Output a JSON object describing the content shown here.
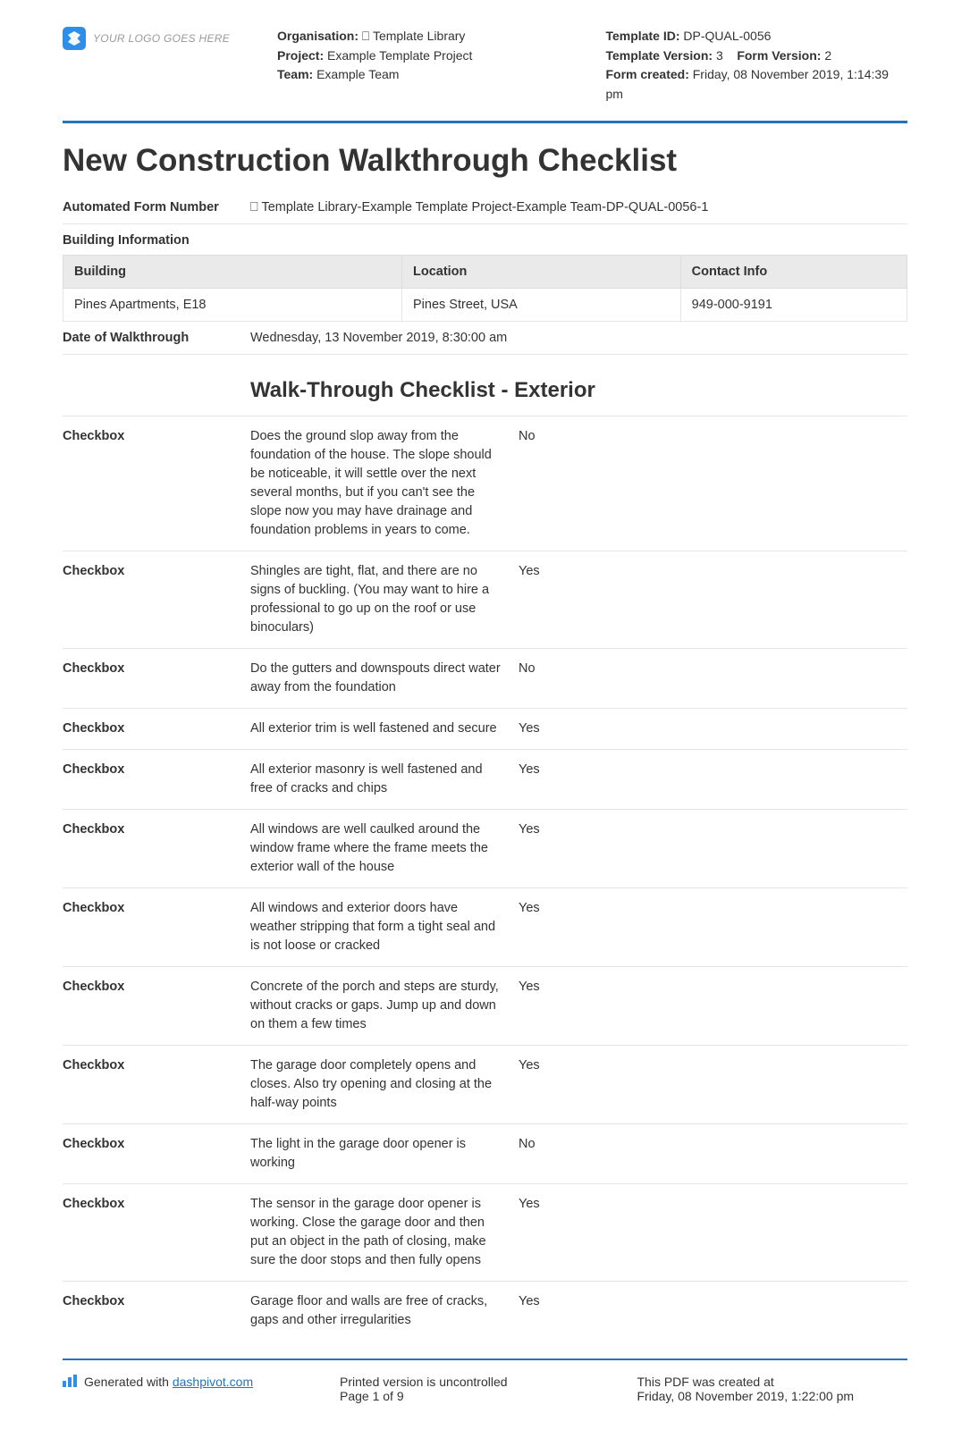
{
  "logo_placeholder": "YOUR LOGO GOES HERE",
  "header": {
    "org_label": "Organisation:",
    "org_value": "⎕ Template Library",
    "project_label": "Project:",
    "project_value": "Example Template Project",
    "team_label": "Team:",
    "team_value": "Example Team",
    "template_id_label": "Template ID:",
    "template_id_value": "DP-QUAL-0056",
    "template_version_label": "Template Version:",
    "template_version_value": "3",
    "form_version_label": "Form Version:",
    "form_version_value": "2",
    "form_created_label": "Form created:",
    "form_created_value": "Friday, 08 November 2019, 1:14:39 pm"
  },
  "title": "New Construction Walkthrough Checklist",
  "afn_label": "Automated Form Number",
  "afn_value": "⎕ Template Library-Example Template Project-Example Team-DP-QUAL-0056-1",
  "building_info_label": "Building Information",
  "building_table": {
    "headers": [
      "Building",
      "Location",
      "Contact Info"
    ],
    "row": [
      "Pines Apartments, E18",
      "Pines Street, USA",
      "949-000-9191"
    ]
  },
  "date_label": "Date of Walkthrough",
  "date_value": "Wednesday, 13 November 2019, 8:30:00 am",
  "subheading": "Walk-Through Checklist - Exterior",
  "checkbox_label": "Checkbox",
  "items": [
    {
      "text": "Does the ground slop away from the foundation of the house. The slope should be noticeable, it will settle over the next several months, but if you can't see the slope now you may have drainage and foundation problems in years to come.",
      "value": "No"
    },
    {
      "text": "Shingles are tight, flat, and there are no signs of buckling. (You may want to hire a professional to go up on the roof or use binoculars)",
      "value": "Yes"
    },
    {
      "text": "Do the gutters and downspouts direct water away from the foundation",
      "value": "No"
    },
    {
      "text": "All exterior trim is well fastened and secure",
      "value": "Yes"
    },
    {
      "text": "All exterior masonry is well fastened and free of cracks and chips",
      "value": "Yes"
    },
    {
      "text": "All windows are well caulked around the window frame where the frame meets the exterior wall of the house",
      "value": "Yes"
    },
    {
      "text": "All windows and exterior doors have weather stripping that form a tight seal and is not loose or cracked",
      "value": "Yes"
    },
    {
      "text": "Concrete of the porch and steps are sturdy, without cracks or gaps. Jump up and down on them a few times",
      "value": "Yes"
    },
    {
      "text": "The garage door completely opens and closes. Also try opening and closing at the half-way points",
      "value": "Yes"
    },
    {
      "text": "The light in the garage door opener is working",
      "value": "No"
    },
    {
      "text": "The sensor in the garage door opener is working. Close the garage door and then put an object in the path of closing, make sure the door stops and then fully opens",
      "value": "Yes"
    },
    {
      "text": "Garage floor and walls are free of cracks, gaps and other irregularities",
      "value": "Yes"
    }
  ],
  "footer": {
    "gen_prefix": "Generated with ",
    "gen_link": "dashpivot.com",
    "uncontrolled": "Printed version is uncontrolled",
    "page": "Page 1 of 9",
    "created_label": "This PDF was created at",
    "created_value": "Friday, 08 November 2019, 1:22:00 pm"
  }
}
